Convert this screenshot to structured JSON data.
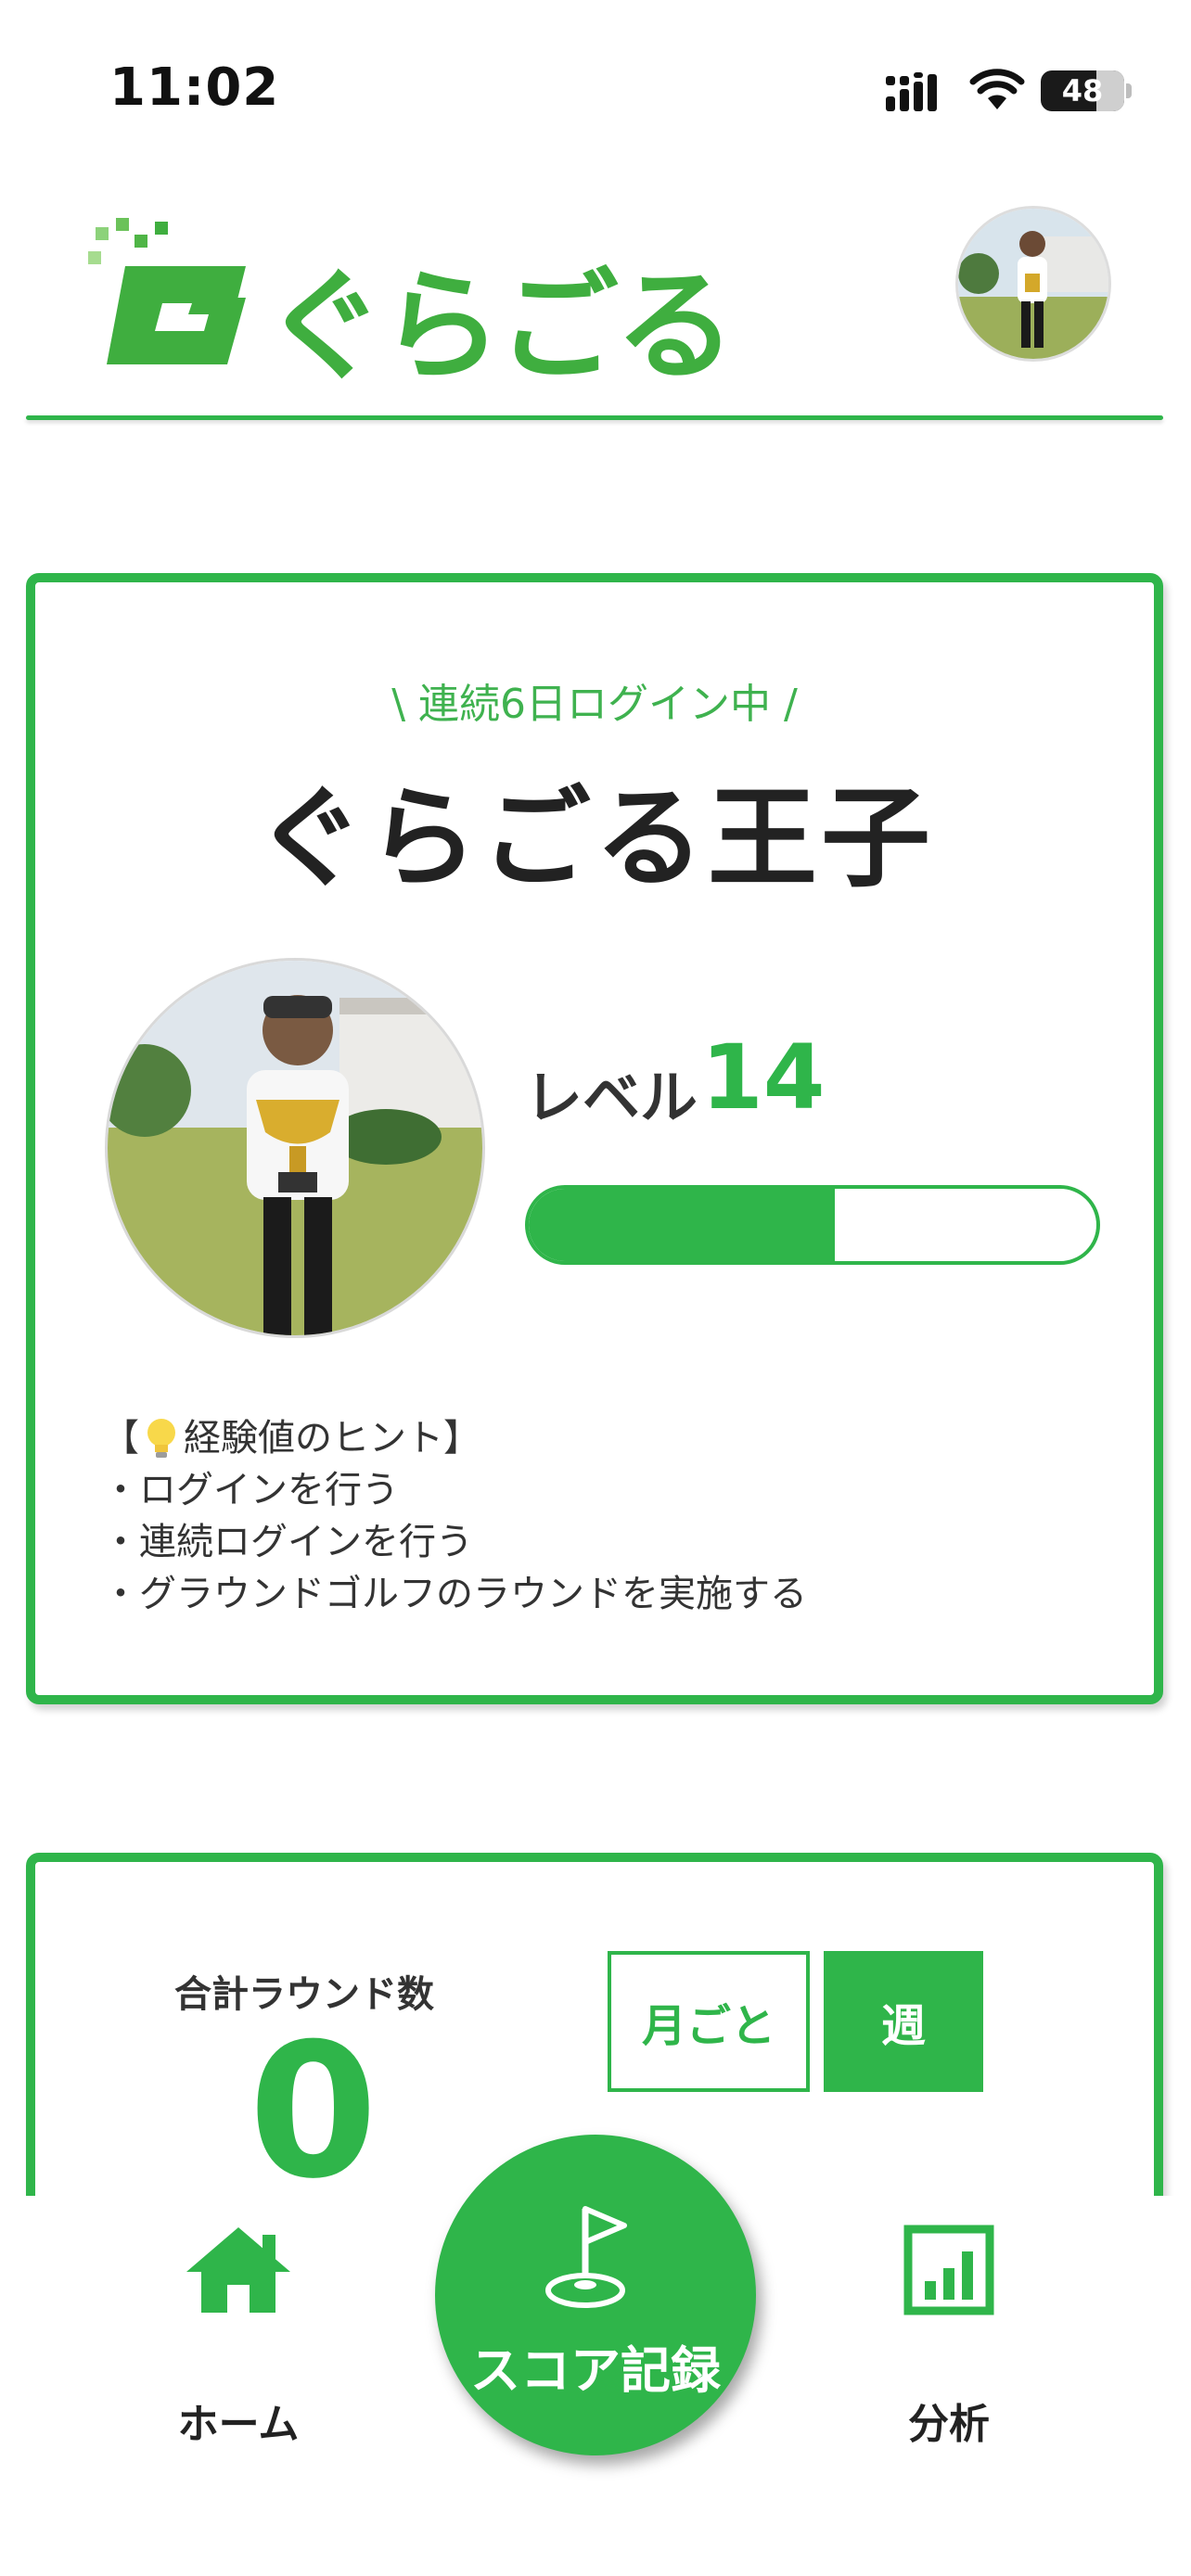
{
  "status_bar": {
    "time": "11:02",
    "battery": "48"
  },
  "header": {
    "logo_text": "ぐらごる"
  },
  "profile": {
    "streak_text": "\\ 連続6日ログイン中 /",
    "title": "ぐらごる王子",
    "level_label": "レベル",
    "level_value": "14",
    "xp_progress": 0.54,
    "hints": {
      "open_bracket": "【",
      "heading": "経験値のヒント】",
      "items": [
        "・ログインを行う",
        "・連続ログインを行う",
        "・グラウンドゴルフのラウンドを実施する"
      ]
    }
  },
  "rounds": {
    "label": "合計ラウンド数",
    "value": "0",
    "period_month": "月ごと",
    "period_week": "週",
    "selected_period": "週"
  },
  "nav": {
    "home_label": "ホーム",
    "score_label": "スコア記録",
    "analysis_label": "分析"
  },
  "colors": {
    "accent": "#2fb54a",
    "text": "#333333"
  }
}
